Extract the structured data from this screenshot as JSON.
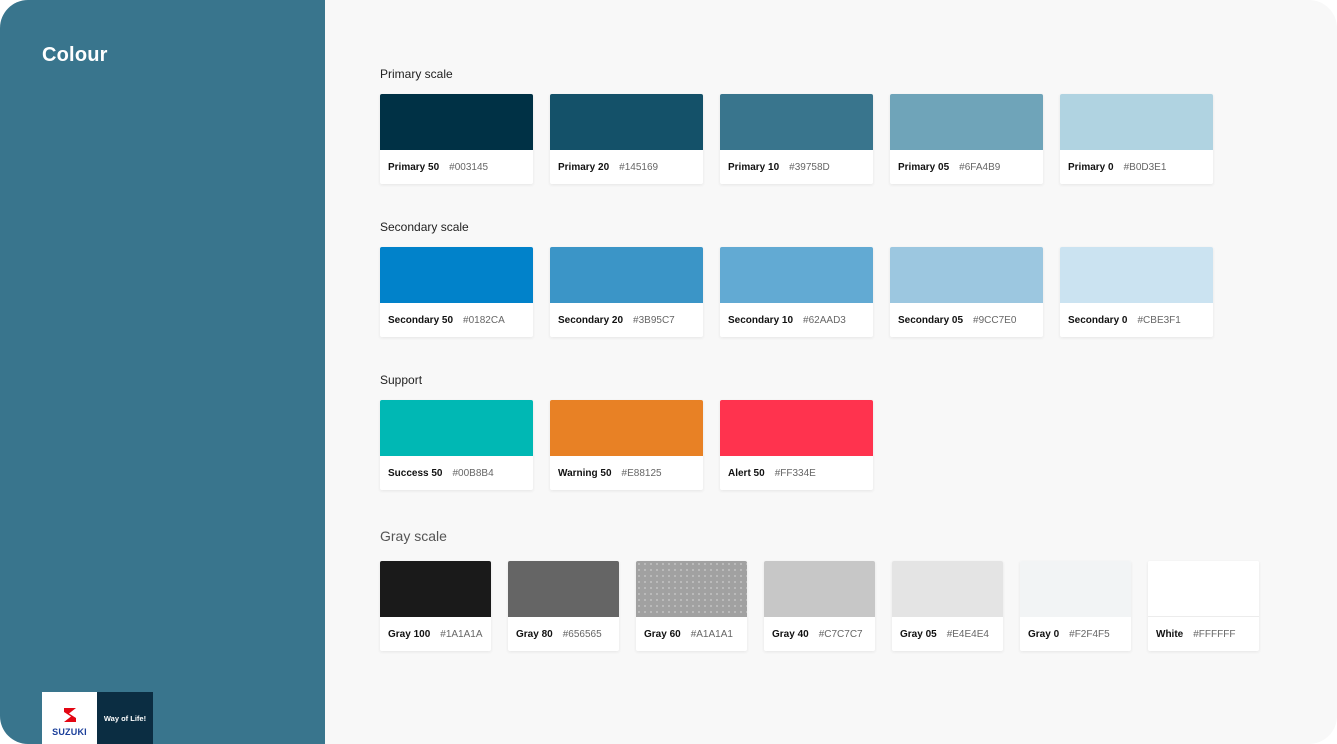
{
  "sidebar": {
    "title": "Colour",
    "logo_word": "SUZUKI",
    "tagline": "Way of Life!",
    "color": "#39758D"
  },
  "sections": {
    "primary": {
      "title": "Primary scale",
      "items": [
        {
          "name": "Primary 50",
          "hex": "#003145"
        },
        {
          "name": "Primary 20",
          "hex": "#145169"
        },
        {
          "name": "Primary 10",
          "hex": "#39758D"
        },
        {
          "name": "Primary 05",
          "hex": "#6FA4B9"
        },
        {
          "name": "Primary 0",
          "hex": "#B0D3E1"
        }
      ]
    },
    "secondary": {
      "title": "Secondary scale",
      "items": [
        {
          "name": "Secondary 50",
          "hex": "#0182CA"
        },
        {
          "name": "Secondary 20",
          "hex": "#3B95C7"
        },
        {
          "name": "Secondary 10",
          "hex": "#62AAD3"
        },
        {
          "name": "Secondary 05",
          "hex": "#9CC7E0"
        },
        {
          "name": "Secondary 0",
          "hex": "#CBE3F1"
        }
      ]
    },
    "support": {
      "title": "Support",
      "items": [
        {
          "name": "Success 50",
          "hex": "#00B8B4"
        },
        {
          "name": "Warning 50",
          "hex": "#E88125"
        },
        {
          "name": "Alert 50",
          "hex": "#FF334E"
        }
      ]
    },
    "gray": {
      "title": "Gray scale",
      "items": [
        {
          "name": "Gray 100",
          "hex": "#1A1A1A"
        },
        {
          "name": "Gray 80",
          "hex": "#656565"
        },
        {
          "name": "Gray 60",
          "hex": "#A1A1A1"
        },
        {
          "name": "Gray 40",
          "hex": "#C7C7C7"
        },
        {
          "name": "Gray 05",
          "hex": "#E4E4E4"
        },
        {
          "name": "Gray 0",
          "hex": "#F2F4F5"
        },
        {
          "name": "White",
          "hex": "#FFFFFF"
        }
      ]
    }
  }
}
